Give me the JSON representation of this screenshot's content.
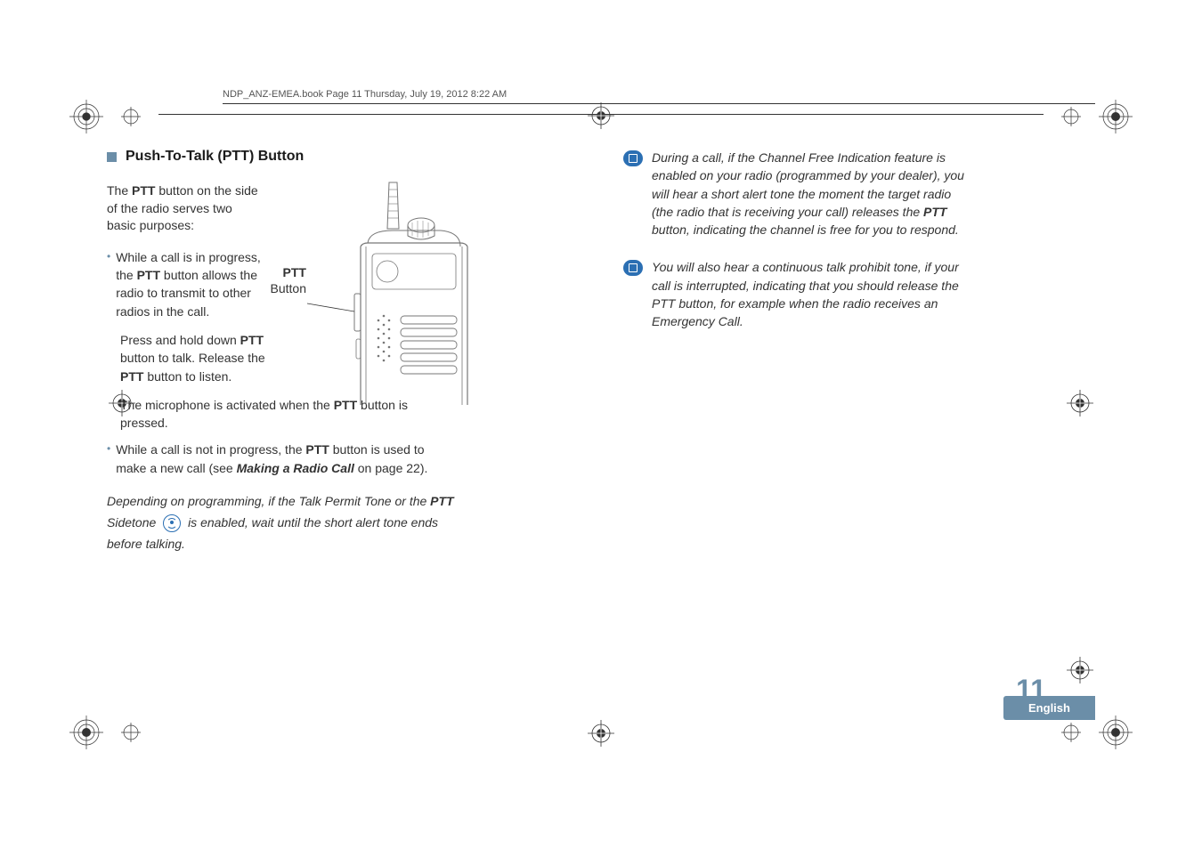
{
  "header": "NDP_ANZ-EMEA.book  Page 11  Thursday, July 19, 2012  8:22 AM",
  "section_title": "Push-To-Talk (PTT) Button",
  "intro_pre": "The ",
  "intro_bold": "PTT",
  "intro_post": " button on the side of the radio serves two basic purposes:",
  "b1_a": "While a call is in progress, the ",
  "b1_bold": "PTT",
  "b1_b": " button allows the radio to transmit to other radios in the call.",
  "sub1_a": "Press and hold down ",
  "sub1_bold1": "PTT",
  "sub1_b": " button to talk. Release the ",
  "sub1_bold2": "PTT",
  "sub1_c": " button to listen.",
  "sub2_a": "The microphone is activated when the ",
  "sub2_bold": "PTT",
  "sub2_b": " button is pressed.",
  "b2_a": "While a call is not in progress, the ",
  "b2_bold": "PTT",
  "b2_b": " button is used to make a new call (see ",
  "b2_link": "Making a Radio Call",
  "b2_c": " on page 22).",
  "italic_a": "Depending on programming, if the Talk Permit Tone or the ",
  "italic_bold": "PTT",
  "italic_b": "Sidetone ",
  "italic_c": " is enabled, wait until the short alert tone ends before talking.",
  "note1_a": "During a call, if the Channel Free Indication feature is enabled on your radio (programmed by your dealer), you will hear a short alert tone the moment the target radio (the radio that is receiving your call) releases the ",
  "note1_bold": "PTT",
  "note1_b": " button, indicating the channel is free for you to respond.",
  "note2": "You will also hear a continuous talk prohibit tone, if your call is interrupted, indicating that you should release the PTT button, for example when the radio receives an Emergency Call.",
  "ptt_label_bold": "PTT",
  "ptt_label_text": "Button",
  "page_number": "11",
  "language": "English"
}
